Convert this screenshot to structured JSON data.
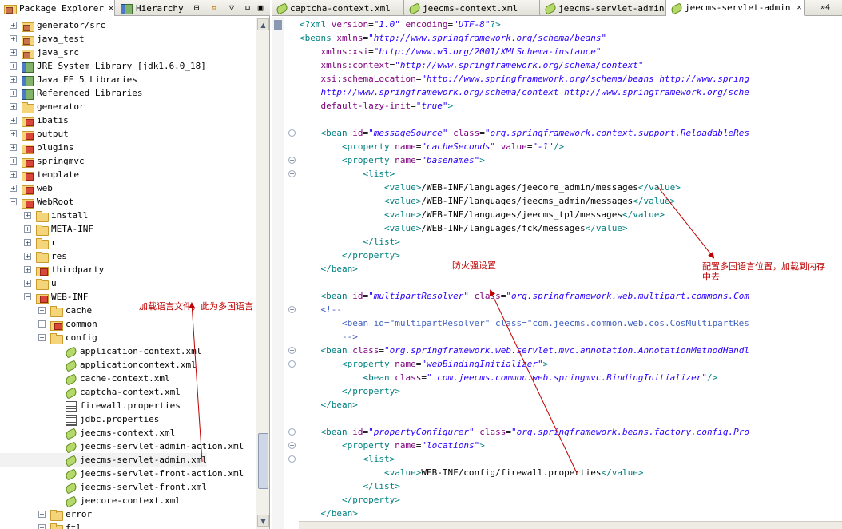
{
  "left_panel": {
    "tabs": [
      {
        "label": "Package Explorer",
        "close": "✕"
      },
      {
        "label": "Hierarchy"
      }
    ],
    "toolbar": {
      "collapse": "⊟",
      "link": "⇆",
      "menu": "▽"
    },
    "tree": [
      {
        "label": "generator/src",
        "indent": 0,
        "exp": "+",
        "icon": "pkgfolder"
      },
      {
        "label": "java_test",
        "indent": 0,
        "exp": "+",
        "icon": "pkgfolder"
      },
      {
        "label": "java_src",
        "indent": 0,
        "exp": "+",
        "icon": "pkgfolder"
      },
      {
        "label": "JRE System Library [jdk1.6.0_18]",
        "indent": 0,
        "exp": "+",
        "icon": "lib"
      },
      {
        "label": "Java EE 5 Libraries",
        "indent": 0,
        "exp": "+",
        "icon": "lib"
      },
      {
        "label": "Referenced Libraries",
        "indent": 0,
        "exp": "+",
        "icon": "lib"
      },
      {
        "label": "generator",
        "indent": 0,
        "exp": "+",
        "icon": "folder"
      },
      {
        "label": "ibatis",
        "indent": 0,
        "exp": "+",
        "icon": "redfolder"
      },
      {
        "label": "output",
        "indent": 0,
        "exp": "+",
        "icon": "redfolder"
      },
      {
        "label": "plugins",
        "indent": 0,
        "exp": "+",
        "icon": "redfolder"
      },
      {
        "label": "springmvc",
        "indent": 0,
        "exp": "+",
        "icon": "redfolder"
      },
      {
        "label": "template",
        "indent": 0,
        "exp": "+",
        "icon": "redfolder"
      },
      {
        "label": "web",
        "indent": 0,
        "exp": "+",
        "icon": "redfolder"
      },
      {
        "label": "WebRoot",
        "indent": 0,
        "exp": "−",
        "icon": "redfolder"
      },
      {
        "label": "install",
        "indent": 1,
        "exp": "+",
        "icon": "folder"
      },
      {
        "label": "META-INF",
        "indent": 1,
        "exp": "+",
        "icon": "folder"
      },
      {
        "label": "r",
        "indent": 1,
        "exp": "+",
        "icon": "folder"
      },
      {
        "label": "res",
        "indent": 1,
        "exp": "+",
        "icon": "folder"
      },
      {
        "label": "thirdparty",
        "indent": 1,
        "exp": "+",
        "icon": "redfolder"
      },
      {
        "label": "u",
        "indent": 1,
        "exp": "+",
        "icon": "folder"
      },
      {
        "label": "WEB-INF",
        "indent": 1,
        "exp": "−",
        "icon": "redfolder"
      },
      {
        "label": "cache",
        "indent": 2,
        "exp": "+",
        "icon": "folder"
      },
      {
        "label": "common",
        "indent": 2,
        "exp": "+",
        "icon": "redfolder"
      },
      {
        "label": "config",
        "indent": 2,
        "exp": "−",
        "icon": "folder"
      },
      {
        "label": "application-context.xml",
        "indent": 3,
        "exp": "",
        "icon": "xml"
      },
      {
        "label": "applicationcontext.xml",
        "indent": 3,
        "exp": "",
        "icon": "xml"
      },
      {
        "label": "cache-context.xml",
        "indent": 3,
        "exp": "",
        "icon": "xml"
      },
      {
        "label": "captcha-context.xml",
        "indent": 3,
        "exp": "",
        "icon": "xml"
      },
      {
        "label": "firewall.properties",
        "indent": 3,
        "exp": "",
        "icon": "props"
      },
      {
        "label": "jdbc.properties",
        "indent": 3,
        "exp": "",
        "icon": "props"
      },
      {
        "label": "jeecms-context.xml",
        "indent": 3,
        "exp": "",
        "icon": "xml"
      },
      {
        "label": "jeecms-servlet-admin-action.xml",
        "indent": 3,
        "exp": "",
        "icon": "xml"
      },
      {
        "label": "jeecms-servlet-admin.xml",
        "indent": 3,
        "exp": "",
        "icon": "xml",
        "selected": true
      },
      {
        "label": "jeecms-servlet-front-action.xml",
        "indent": 3,
        "exp": "",
        "icon": "xml"
      },
      {
        "label": "jeecms-servlet-front.xml",
        "indent": 3,
        "exp": "",
        "icon": "xml"
      },
      {
        "label": "jeecore-context.xml",
        "indent": 3,
        "exp": "",
        "icon": "xml"
      },
      {
        "label": "error",
        "indent": 2,
        "exp": "+",
        "icon": "folder"
      },
      {
        "label": "ftl",
        "indent": 2,
        "exp": "+",
        "icon": "folder"
      }
    ],
    "scroll": {
      "up": "▲",
      "down": "▼"
    }
  },
  "editor": {
    "tabs": [
      {
        "label": "captcha-context.xml"
      },
      {
        "label": "jeecms-context.xml"
      },
      {
        "label": "jeecms-servlet-admin"
      },
      {
        "label": "jeecms-servlet-admin",
        "active": true,
        "close": "✕"
      }
    ],
    "more_tabs": "»4",
    "lines": [
      {
        "fold": false,
        "segs": [
          [
            "t",
            "<?xml "
          ],
          [
            "a",
            "version"
          ],
          [
            "txt",
            "="
          ],
          [
            "v",
            "\"1.0\""
          ],
          [
            "txt",
            " "
          ],
          [
            "a",
            "encoding"
          ],
          [
            "txt",
            "="
          ],
          [
            "v",
            "\"UTF-8\""
          ],
          [
            "t",
            "?>"
          ]
        ]
      },
      {
        "fold": false,
        "segs": [
          [
            "t",
            "<beans "
          ],
          [
            "a",
            "xmlns"
          ],
          [
            "txt",
            "="
          ],
          [
            "v",
            "\"http://www.springframework.org/schema/beans\""
          ]
        ]
      },
      {
        "fold": false,
        "segs": [
          [
            "txt",
            "    "
          ],
          [
            "a",
            "xmlns:xsi"
          ],
          [
            "txt",
            "="
          ],
          [
            "v",
            "\"http://www.w3.org/2001/XMLSchema-instance\""
          ]
        ]
      },
      {
        "fold": false,
        "segs": [
          [
            "txt",
            "    "
          ],
          [
            "a",
            "xmlns:context"
          ],
          [
            "txt",
            "="
          ],
          [
            "v",
            "\"http://www.springframework.org/schema/context\""
          ]
        ]
      },
      {
        "fold": false,
        "segs": [
          [
            "txt",
            "    "
          ],
          [
            "a",
            "xsi:schemaLocation"
          ],
          [
            "txt",
            "="
          ],
          [
            "v",
            "\"http://www.springframework.org/schema/beans http://www.spring"
          ]
        ]
      },
      {
        "fold": false,
        "segs": [
          [
            "txt",
            "    "
          ],
          [
            "v",
            "http://www.springframework.org/schema/context http://www.springframework.org/sche"
          ]
        ]
      },
      {
        "fold": false,
        "segs": [
          [
            "txt",
            "    "
          ],
          [
            "a",
            "default-lazy-init"
          ],
          [
            "txt",
            "="
          ],
          [
            "v",
            "\"true\""
          ],
          [
            "t",
            ">"
          ]
        ]
      },
      {
        "fold": false,
        "segs": [
          [
            "txt",
            ""
          ]
        ]
      },
      {
        "fold": true,
        "segs": [
          [
            "txt",
            "    "
          ],
          [
            "t",
            "<bean "
          ],
          [
            "a",
            "id"
          ],
          [
            "txt",
            "="
          ],
          [
            "v",
            "\"messageSource\""
          ],
          [
            "txt",
            " "
          ],
          [
            "a",
            "class"
          ],
          [
            "txt",
            "="
          ],
          [
            "v",
            "\"org.springframework.context.support.ReloadableRes"
          ]
        ]
      },
      {
        "fold": false,
        "segs": [
          [
            "txt",
            "        "
          ],
          [
            "t",
            "<property "
          ],
          [
            "a",
            "name"
          ],
          [
            "txt",
            "="
          ],
          [
            "v",
            "\"cacheSeconds\""
          ],
          [
            "txt",
            " "
          ],
          [
            "a",
            "value"
          ],
          [
            "txt",
            "="
          ],
          [
            "v",
            "\"-1\""
          ],
          [
            "t",
            "/>"
          ]
        ]
      },
      {
        "fold": true,
        "segs": [
          [
            "txt",
            "        "
          ],
          [
            "t",
            "<property "
          ],
          [
            "a",
            "name"
          ],
          [
            "txt",
            "="
          ],
          [
            "v",
            "\"basenames\""
          ],
          [
            "t",
            ">"
          ]
        ]
      },
      {
        "fold": true,
        "segs": [
          [
            "txt",
            "            "
          ],
          [
            "t",
            "<list>"
          ]
        ]
      },
      {
        "fold": false,
        "segs": [
          [
            "txt",
            "                "
          ],
          [
            "t",
            "<value>"
          ],
          [
            "txt",
            "/WEB-INF/languages/jeecore_admin/messages"
          ],
          [
            "t",
            "</value>"
          ]
        ]
      },
      {
        "fold": false,
        "segs": [
          [
            "txt",
            "                "
          ],
          [
            "t",
            "<value>"
          ],
          [
            "txt",
            "/WEB-INF/languages/jeecms_admin/messages"
          ],
          [
            "t",
            "</value>"
          ]
        ]
      },
      {
        "fold": false,
        "segs": [
          [
            "txt",
            "                "
          ],
          [
            "t",
            "<value>"
          ],
          [
            "txt",
            "/WEB-INF/languages/jeecms_tpl/messages"
          ],
          [
            "t",
            "</value>"
          ]
        ]
      },
      {
        "fold": false,
        "segs": [
          [
            "txt",
            "                "
          ],
          [
            "t",
            "<value>"
          ],
          [
            "txt",
            "/WEB-INF/languages/fck/messages"
          ],
          [
            "t",
            "</value>"
          ]
        ]
      },
      {
        "fold": false,
        "segs": [
          [
            "txt",
            "            "
          ],
          [
            "t",
            "</list>"
          ]
        ]
      },
      {
        "fold": false,
        "segs": [
          [
            "txt",
            "        "
          ],
          [
            "t",
            "</property>"
          ]
        ]
      },
      {
        "fold": false,
        "segs": [
          [
            "txt",
            "    "
          ],
          [
            "t",
            "</bean>"
          ]
        ]
      },
      {
        "fold": false,
        "segs": [
          [
            "txt",
            ""
          ]
        ]
      },
      {
        "fold": false,
        "segs": [
          [
            "txt",
            "    "
          ],
          [
            "t",
            "<bean "
          ],
          [
            "a",
            "id"
          ],
          [
            "txt",
            "="
          ],
          [
            "v",
            "\"multipartResolver\""
          ],
          [
            "txt",
            " "
          ],
          [
            "a",
            "class"
          ],
          [
            "txt",
            "="
          ],
          [
            "v",
            "\"org.springframework.web.multipart.commons.Com"
          ]
        ]
      },
      {
        "fold": true,
        "segs": [
          [
            "txt",
            "    "
          ],
          [
            "c",
            "<!--"
          ]
        ]
      },
      {
        "fold": false,
        "segs": [
          [
            "txt",
            "        "
          ],
          [
            "c",
            "<bean id=\"multipartResolver\" class=\"com.jeecms.common.web.cos.CosMultipartRes"
          ]
        ]
      },
      {
        "fold": false,
        "segs": [
          [
            "txt",
            "        "
          ],
          [
            "c",
            "-->"
          ]
        ]
      },
      {
        "fold": true,
        "segs": [
          [
            "txt",
            "    "
          ],
          [
            "t",
            "<bean "
          ],
          [
            "a",
            "class"
          ],
          [
            "txt",
            "="
          ],
          [
            "v",
            "\"org.springframework.web.servlet.mvc.annotation.AnnotationMethodHandl"
          ]
        ]
      },
      {
        "fold": true,
        "segs": [
          [
            "txt",
            "        "
          ],
          [
            "t",
            "<property "
          ],
          [
            "a",
            "name"
          ],
          [
            "txt",
            "="
          ],
          [
            "v",
            "\"webBindingInitializer\""
          ],
          [
            "t",
            ">"
          ]
        ]
      },
      {
        "fold": false,
        "segs": [
          [
            "txt",
            "            "
          ],
          [
            "t",
            "<bean "
          ],
          [
            "a",
            "class"
          ],
          [
            "txt",
            "="
          ],
          [
            "v",
            "\" com.jeecms.common.web.springmvc.BindingInitializer\""
          ],
          [
            "t",
            "/>"
          ]
        ]
      },
      {
        "fold": false,
        "segs": [
          [
            "txt",
            "        "
          ],
          [
            "t",
            "</property>"
          ]
        ]
      },
      {
        "fold": false,
        "segs": [
          [
            "txt",
            "    "
          ],
          [
            "t",
            "</bean>"
          ]
        ]
      },
      {
        "fold": false,
        "segs": [
          [
            "txt",
            ""
          ]
        ]
      },
      {
        "fold": true,
        "segs": [
          [
            "txt",
            "    "
          ],
          [
            "t",
            "<bean "
          ],
          [
            "a",
            "id"
          ],
          [
            "txt",
            "="
          ],
          [
            "v",
            "\"propertyConfigurer\""
          ],
          [
            "txt",
            " "
          ],
          [
            "a",
            "class"
          ],
          [
            "txt",
            "="
          ],
          [
            "v",
            "\"org.springframework.beans.factory.config.Pro"
          ]
        ]
      },
      {
        "fold": true,
        "segs": [
          [
            "txt",
            "        "
          ],
          [
            "t",
            "<property "
          ],
          [
            "a",
            "name"
          ],
          [
            "txt",
            "="
          ],
          [
            "v",
            "\"locations\""
          ],
          [
            "t",
            ">"
          ]
        ]
      },
      {
        "fold": true,
        "segs": [
          [
            "txt",
            "            "
          ],
          [
            "t",
            "<list>"
          ]
        ]
      },
      {
        "fold": false,
        "segs": [
          [
            "txt",
            "                "
          ],
          [
            "t",
            "<value>"
          ],
          [
            "txt",
            "WEB-INF/config/firewall.properties"
          ],
          [
            "t",
            "</value>"
          ]
        ]
      },
      {
        "fold": false,
        "segs": [
          [
            "txt",
            "            "
          ],
          [
            "t",
            "</list>"
          ]
        ]
      },
      {
        "fold": false,
        "segs": [
          [
            "txt",
            "        "
          ],
          [
            "t",
            "</property>"
          ]
        ]
      },
      {
        "fold": false,
        "segs": [
          [
            "txt",
            "    "
          ],
          [
            "t",
            "</bean>"
          ]
        ]
      }
    ]
  },
  "annotations": {
    "load_language": "加载语言文件，此为多国语言",
    "firewall": "防火强设置",
    "config_line1": "配置多国语言位置，加载到内存",
    "config_line2": "中去"
  },
  "colors": {
    "tag": "#008080",
    "attr": "#7f007f",
    "value": "#2a00ff",
    "comment": "#3f5fbf",
    "annotation": "#c00000"
  }
}
